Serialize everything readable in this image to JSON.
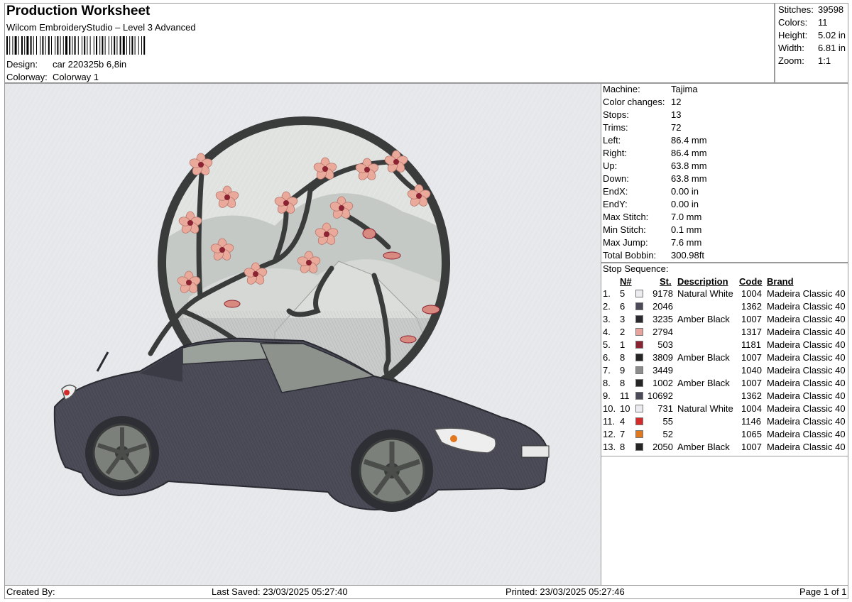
{
  "header": {
    "title": "Production Worksheet",
    "subtitle": "Wilcom EmbroideryStudio – Level 3 Advanced",
    "barcode_label": "barcode",
    "design_label": "Design:",
    "design_value": "car 220325b 6,8in",
    "colorway_label": "Colorway:",
    "colorway_value": "Colorway 1"
  },
  "stats": [
    {
      "label": "Stitches:",
      "value": "39598"
    },
    {
      "label": "Colors:",
      "value": "11"
    },
    {
      "label": "Height:",
      "value": "5.02 in"
    },
    {
      "label": "Width:",
      "value": "6.81 in"
    },
    {
      "label": "Zoom:",
      "value": "1:1"
    }
  ],
  "machine": [
    {
      "label": "Machine:",
      "value": "Tajima"
    },
    {
      "label": "Color changes:",
      "value": "12"
    },
    {
      "label": "Stops:",
      "value": "13"
    },
    {
      "label": "Trims:",
      "value": "72"
    },
    {
      "label": "Left:",
      "value": "86.4 mm"
    },
    {
      "label": "Right:",
      "value": "86.4 mm"
    },
    {
      "label": "Up:",
      "value": "63.8 mm"
    },
    {
      "label": "Down:",
      "value": "63.8 mm"
    },
    {
      "label": "EndX:",
      "value": "0.00 in"
    },
    {
      "label": "EndY:",
      "value": "0.00 in"
    },
    {
      "label": "Max Stitch:",
      "value": "7.0 mm"
    },
    {
      "label": "Min Stitch:",
      "value": "0.1 mm"
    },
    {
      "label": "Max Jump:",
      "value": "7.6 mm"
    },
    {
      "label": "Total Bobbin:",
      "value": "300.98ft"
    }
  ],
  "stop_sequence": {
    "title": "Stop Sequence:",
    "headers": {
      "n": "N#",
      "st": "St.",
      "description": "Description",
      "code": "Code",
      "brand": "Brand"
    },
    "rows": [
      {
        "idx": "1.",
        "n": "5",
        "color": "#ebebf0",
        "st": "9178",
        "description": "Natural White",
        "code": "1004",
        "brand": "Madeira Classic 40"
      },
      {
        "idx": "2.",
        "n": "6",
        "color": "#4a4a58",
        "st": "2046",
        "description": "",
        "code": "1362",
        "brand": "Madeira Classic 40"
      },
      {
        "idx": "3.",
        "n": "3",
        "color": "#2a2a2e",
        "st": "3235",
        "description": "Amber Black",
        "code": "1007",
        "brand": "Madeira Classic 40"
      },
      {
        "idx": "4.",
        "n": "2",
        "color": "#e7a39c",
        "st": "2794",
        "description": "",
        "code": "1317",
        "brand": "Madeira Classic 40"
      },
      {
        "idx": "5.",
        "n": "1",
        "color": "#8b2332",
        "st": "503",
        "description": "",
        "code": "1181",
        "brand": "Madeira Classic 40"
      },
      {
        "idx": "6.",
        "n": "8",
        "color": "#252525",
        "st": "3809",
        "description": "Amber Black",
        "code": "1007",
        "brand": "Madeira Classic 40"
      },
      {
        "idx": "7.",
        "n": "9",
        "color": "#8c8c8c",
        "st": "3449",
        "description": "",
        "code": "1040",
        "brand": "Madeira Classic 40"
      },
      {
        "idx": "8.",
        "n": "8",
        "color": "#252525",
        "st": "1002",
        "description": "Amber Black",
        "code": "1007",
        "brand": "Madeira Classic 40"
      },
      {
        "idx": "9.",
        "n": "11",
        "color": "#4a4a58",
        "st": "10692",
        "description": "",
        "code": "1362",
        "brand": "Madeira Classic 40"
      },
      {
        "idx": "10.",
        "n": "10",
        "color": "#ebebf0",
        "st": "731",
        "description": "Natural White",
        "code": "1004",
        "brand": "Madeira Classic 40"
      },
      {
        "idx": "11.",
        "n": "4",
        "color": "#d42a2a",
        "st": "55",
        "description": "",
        "code": "1146",
        "brand": "Madeira Classic 40"
      },
      {
        "idx": "12.",
        "n": "7",
        "color": "#e2781e",
        "st": "52",
        "description": "",
        "code": "1065",
        "brand": "Madeira Classic 40"
      },
      {
        "idx": "13.",
        "n": "8",
        "color": "#252525",
        "st": "2050",
        "description": "Amber Black",
        "code": "1007",
        "brand": "Madeira Classic 40"
      }
    ]
  },
  "footer": {
    "created_by": "Created By:",
    "last_saved": "Last Saved: 23/03/2025 05:27:40",
    "printed": "Printed: 23/03/2025 05:27:46",
    "page": "Page 1 of 1"
  },
  "colors": {
    "canvas_bg": "#e8e8ea",
    "car_body": "#4b4c58",
    "circle_ring": "#3a3c3c",
    "blossom": "#e7a39c",
    "blossom_center": "#8b2332",
    "branch": "#3a3c3c",
    "mountain": "#c8ccc8"
  }
}
